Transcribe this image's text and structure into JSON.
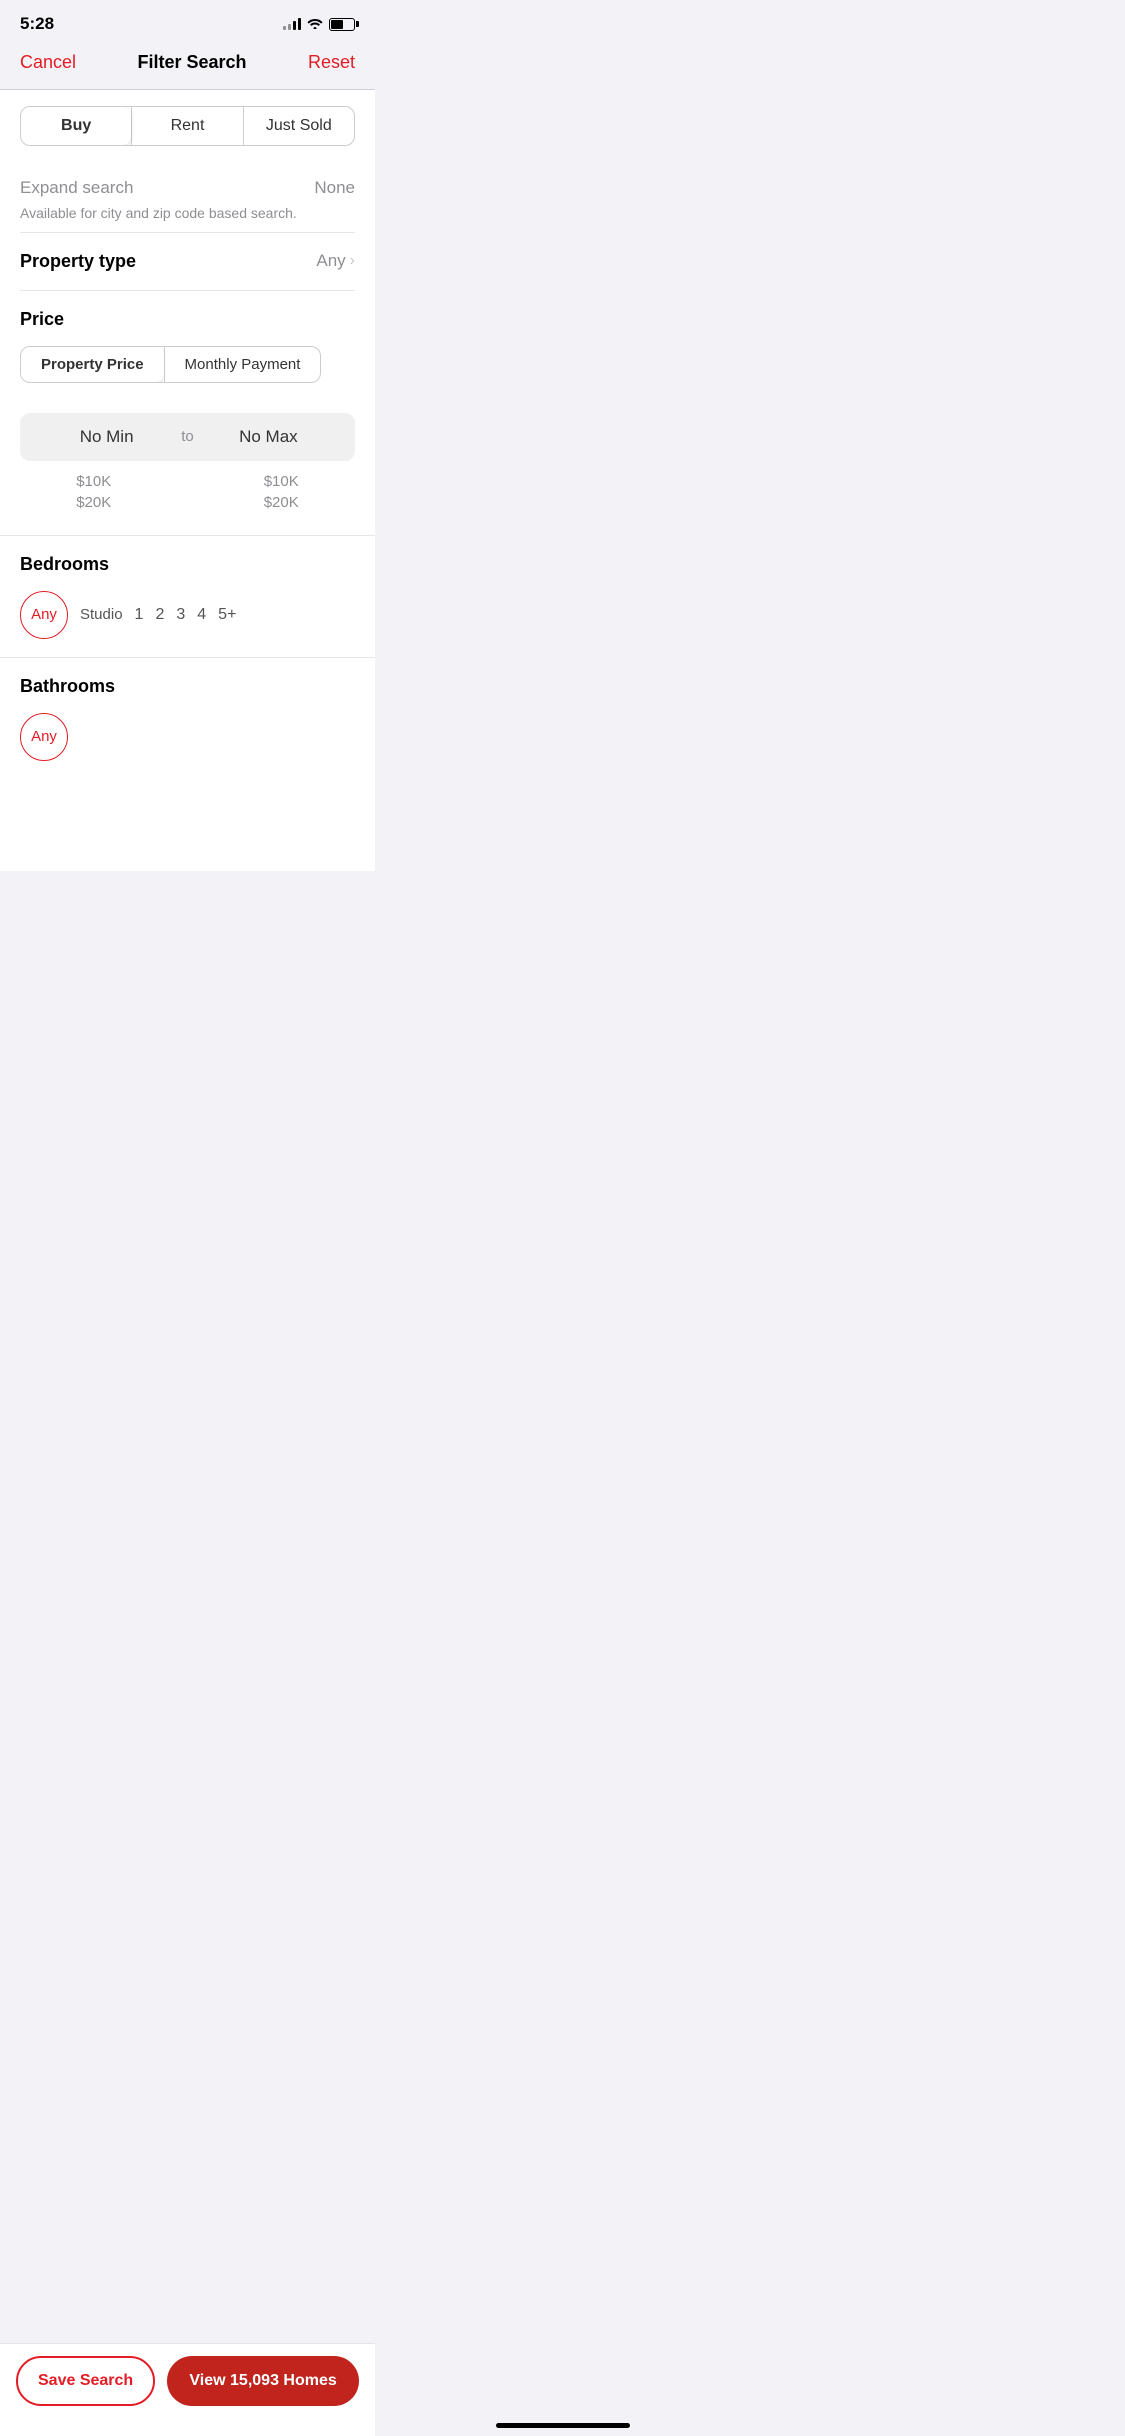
{
  "statusBar": {
    "time": "5:28",
    "signalBars": [
      4,
      6,
      8,
      10
    ],
    "battery": 55
  },
  "header": {
    "cancelLabel": "Cancel",
    "title": "Filter Search",
    "resetLabel": "Reset"
  },
  "searchType": {
    "options": [
      "Buy",
      "Rent",
      "Just Sold"
    ],
    "activeIndex": 0
  },
  "expandSearch": {
    "label": "Expand search",
    "value": "None",
    "description": "Available for city and zip code based search."
  },
  "propertyType": {
    "label": "Property type",
    "value": "Any"
  },
  "price": {
    "sectionTitle": "Price",
    "toggleOptions": [
      "Property Price",
      "Monthly Payment"
    ],
    "activeToggle": 0,
    "minLabel": "No Min",
    "toLabel": "to",
    "maxLabel": "No Max",
    "minOptions": [
      "$10K",
      "$20K"
    ],
    "maxOptions": [
      "$10K",
      "$20K"
    ]
  },
  "bedrooms": {
    "sectionTitle": "Bedrooms",
    "options": [
      "Any",
      "Studio",
      "1",
      "2",
      "3",
      "4",
      "5+"
    ],
    "activeIndex": 0
  },
  "bathrooms": {
    "sectionTitle": "Bathrooms"
  },
  "footer": {
    "saveSearchLabel": "Save Search",
    "viewHomesLabel": "View 15,093 Homes"
  }
}
